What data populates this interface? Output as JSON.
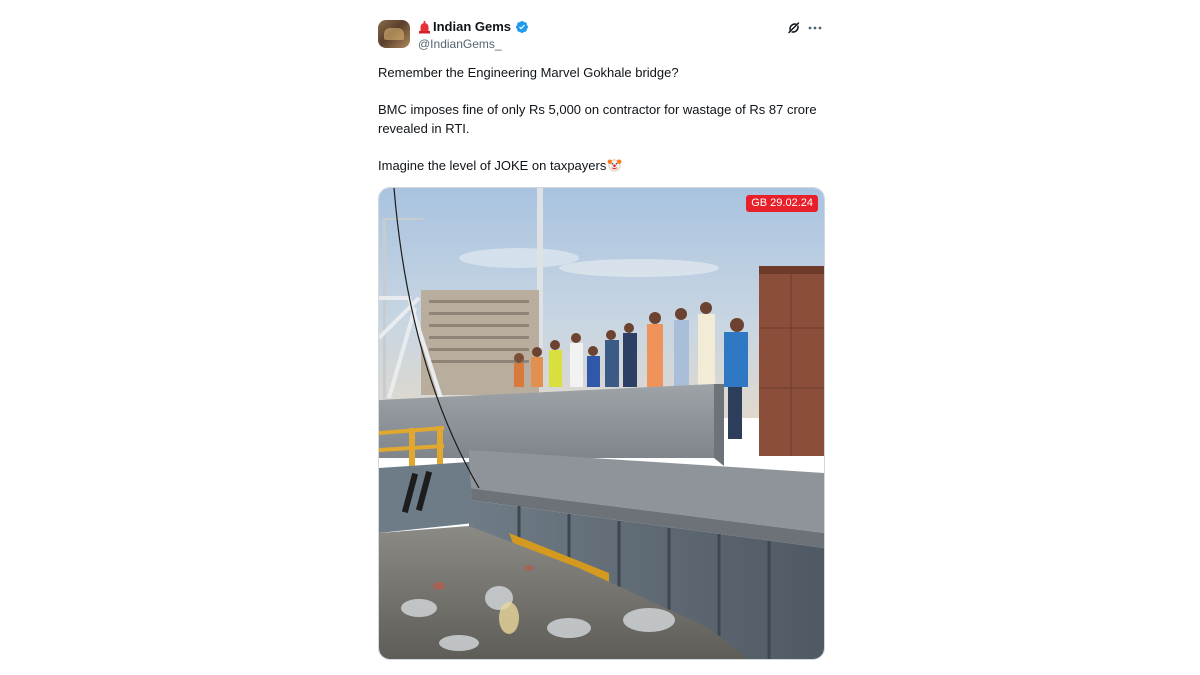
{
  "tweet": {
    "author_name": "Indian Gems",
    "author_handle": "@IndianGems_",
    "paragraphs": [
      "Remember the Engineering Marvel Gokhale bridge?",
      "BMC imposes fine of only Rs 5,000 on contractor for wastage of Rs 87 crore revealed in RTI.",
      "Imagine the level of JOKE on taxpayers"
    ],
    "media_overlay_text": "GB 29.02.24"
  },
  "icons": {
    "flag": "red-siren-icon",
    "verified": "verified-badge-icon",
    "grok": "grok-icon",
    "more": "more-options-icon",
    "emoji": "clown-face-emoji"
  },
  "colors": {
    "text_primary": "#0f1419",
    "text_secondary": "#536471",
    "verified_blue": "#1d9bf0",
    "badge_red": "#e8202a"
  }
}
